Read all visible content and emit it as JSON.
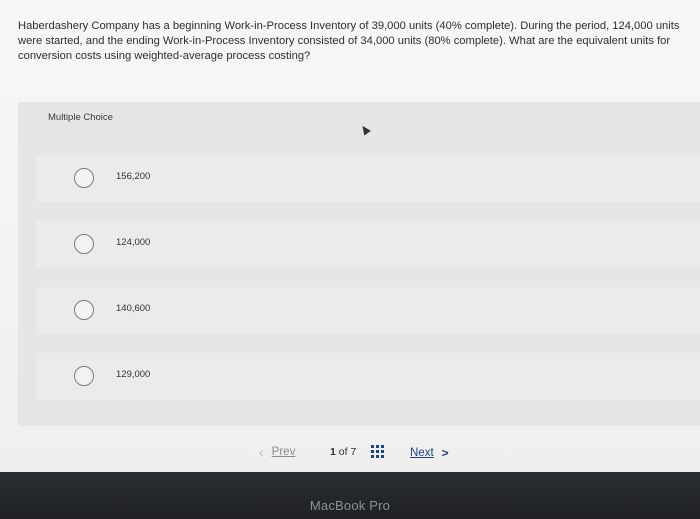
{
  "question": {
    "text": "Haberdashery Company has a beginning Work-in-Process Inventory of 39,000 units (40% complete). During the period, 124,000 units were started, and the ending Work-in-Process Inventory consisted of 34,000 units (80% complete). What are the equivalent units for conversion costs using weighted-average process costing?"
  },
  "multiple_choice": {
    "label": "Multiple Choice",
    "options": [
      {
        "label": "156,200"
      },
      {
        "label": "124,000"
      },
      {
        "label": "140,600"
      },
      {
        "label": "129,000"
      }
    ]
  },
  "navigation": {
    "prev_label": "Prev",
    "page_current": "1",
    "page_of": "of",
    "page_total": "7",
    "next_label": "Next"
  },
  "device": {
    "label": "MacBook Pro"
  }
}
